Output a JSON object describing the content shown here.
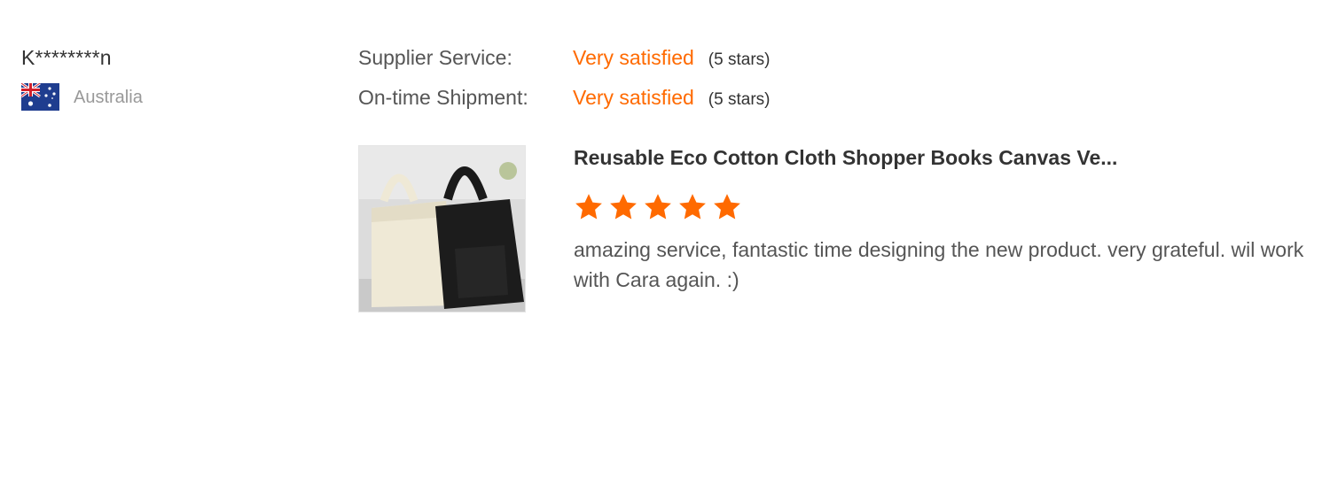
{
  "reviewer": {
    "name": "K********n",
    "country": "Australia",
    "flag_icon": "australia-flag-icon"
  },
  "ratings": [
    {
      "label": "Supplier Service:",
      "value": "Very satisfied",
      "stars": "(5 stars)"
    },
    {
      "label": "On-time Shipment:",
      "value": "Very satisfied",
      "stars": "(5 stars)"
    }
  ],
  "product": {
    "title": "Reusable Eco Cotton Cloth Shopper Books Canvas Ve...",
    "rating_stars": 5,
    "rating_max": 5,
    "star_icon": "star-icon",
    "review_text": "amazing service, fantastic time designing the new product. very grateful. wil work with Cara again. :)"
  },
  "colors": {
    "accent": "#ff6a00",
    "text": "#333333",
    "muted": "#999999"
  }
}
